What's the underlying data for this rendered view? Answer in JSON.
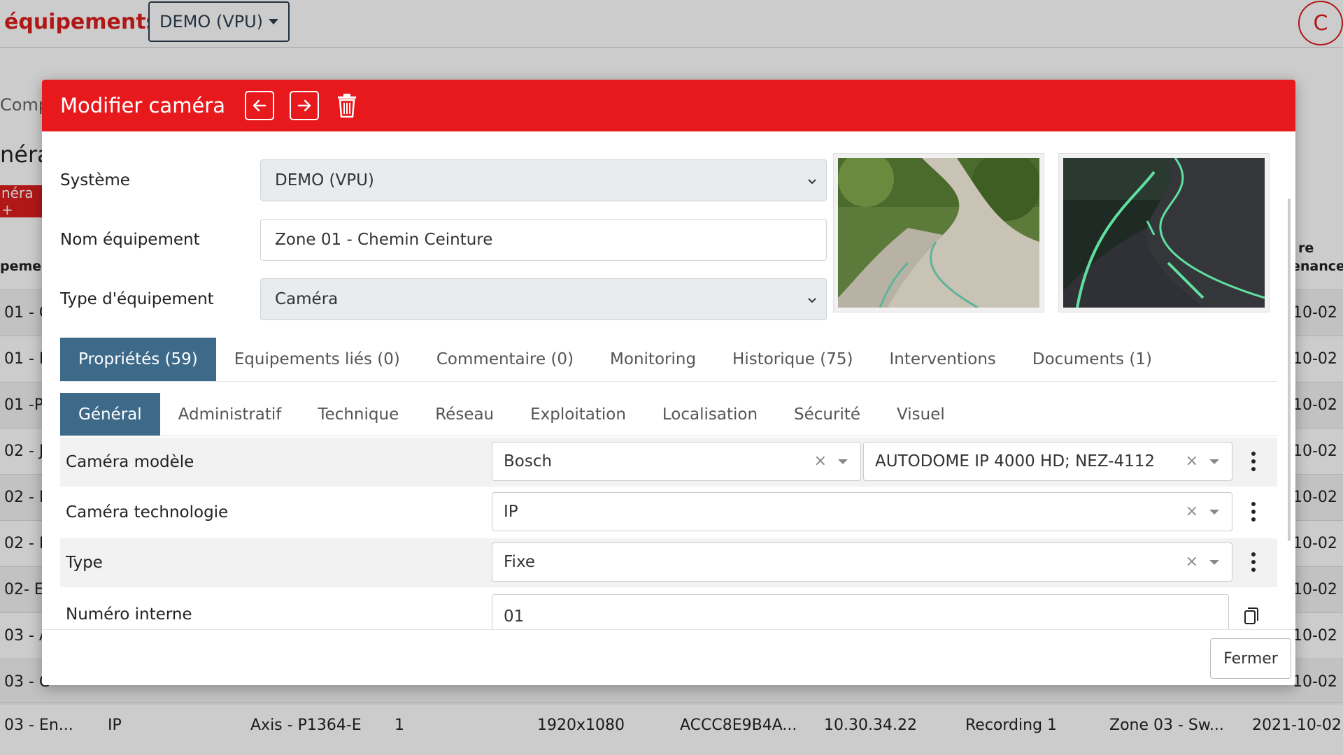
{
  "background": {
    "title": "équipements",
    "system_button": "DEMO (VPU)",
    "avatar_initial": "C",
    "tab_partial": "Comp",
    "section_partial": "néra",
    "red_button_partial": "néra +",
    "col_head_left": "pement",
    "col_head_right1": "re",
    "col_head_right2": "enance",
    "rows": [
      {
        "name": "01 - C",
        "date": "10-02"
      },
      {
        "name": "01 - E",
        "date": "10-02"
      },
      {
        "name": "01 -P",
        "date": "10-02"
      },
      {
        "name": "02 - J",
        "date": "10-02"
      },
      {
        "name": "02 - P",
        "date": "10-02"
      },
      {
        "name": "02 - P",
        "date": "10-02"
      },
      {
        "name": "02- E",
        "date": "10-02"
      },
      {
        "name": "03 - A",
        "date": "10-02"
      },
      {
        "name": "03 - C",
        "date": "10-02"
      }
    ],
    "last_row": {
      "name": "03 - En...",
      "tech": "IP",
      "model": "Axis - P1364-E",
      "num": "1",
      "resolution": "1920x1080",
      "mac": "ACCC8E9B4A...",
      "ip": "10.30.34.22",
      "recording": "Recording 1",
      "zone": "Zone 03 - Sw...",
      "date": "2021-10-02"
    }
  },
  "modal": {
    "title": "Modifier caméra",
    "icons": {
      "prev": "arrow-left-icon",
      "next": "arrow-right-icon",
      "delete": "trash-icon"
    },
    "fields": {
      "system_label": "Système",
      "system_value": "DEMO (VPU)",
      "name_label": "Nom équipement",
      "name_value": "Zone 01 - Chemin Ceinture",
      "type_label": "Type d'équipement",
      "type_value": "Caméra"
    },
    "main_tabs": [
      "Propriétés (59)",
      "Equipements liés (0)",
      "Commentaire (0)",
      "Monitoring",
      "Historique (75)",
      "Interventions",
      "Documents (1)"
    ],
    "sub_tabs": [
      "Général",
      "Administratif",
      "Technique",
      "Réseau",
      "Exploitation",
      "Localisation",
      "Sécurité",
      "Visuel"
    ],
    "properties": {
      "model_label": "Caméra modèle",
      "model_brand": "Bosch",
      "model_value": "AUTODOME IP 4000 HD; NEZ-4112",
      "tech_label": "Caméra technologie",
      "tech_value": "IP",
      "type_label": "Type",
      "type_value": "Fixe",
      "internal_label": "Numéro interne",
      "internal_value": "01",
      "clear_symbol": "×"
    },
    "close_button": "Fermer"
  },
  "colors": {
    "header_red": "#e8191c",
    "tab_active": "#3e6a8a",
    "brand_red": "#dc1e1e"
  }
}
